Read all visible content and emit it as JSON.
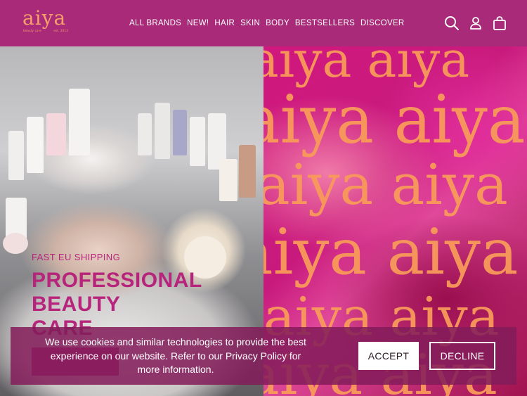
{
  "brand": {
    "logo_text": "aiya",
    "logo_sub_left": "beauty care",
    "logo_sub_right": "est. 2013"
  },
  "nav": {
    "items": [
      {
        "label": "ALL BRANDS"
      },
      {
        "label": "NEW!"
      },
      {
        "label": "HAIR"
      },
      {
        "label": "SKIN"
      },
      {
        "label": "BODY"
      },
      {
        "label": "BESTSELLERS"
      },
      {
        "label": "DISCOVER"
      }
    ]
  },
  "header_icons": [
    "search-icon",
    "account-icon",
    "cart-icon"
  ],
  "hero": {
    "kicker": "FAST EU SHIPPING",
    "title_lines": [
      "PROFESSIONAL",
      "BEAUTY",
      "CARE"
    ]
  },
  "pattern_text": "aiya",
  "cookie": {
    "message": "We use cookies and similar technologies to provide the best experience on our website. Refer to our Privacy Policy for more information.",
    "accept_label": "ACCEPT",
    "decline_label": "DECLINE"
  },
  "colors": {
    "header_bg": "#a82a78",
    "brand_accent": "#b7247b",
    "logo_orange": "#f6a06a",
    "pattern_text": "#f89a5a",
    "cookie_bg": "#821c5a"
  }
}
